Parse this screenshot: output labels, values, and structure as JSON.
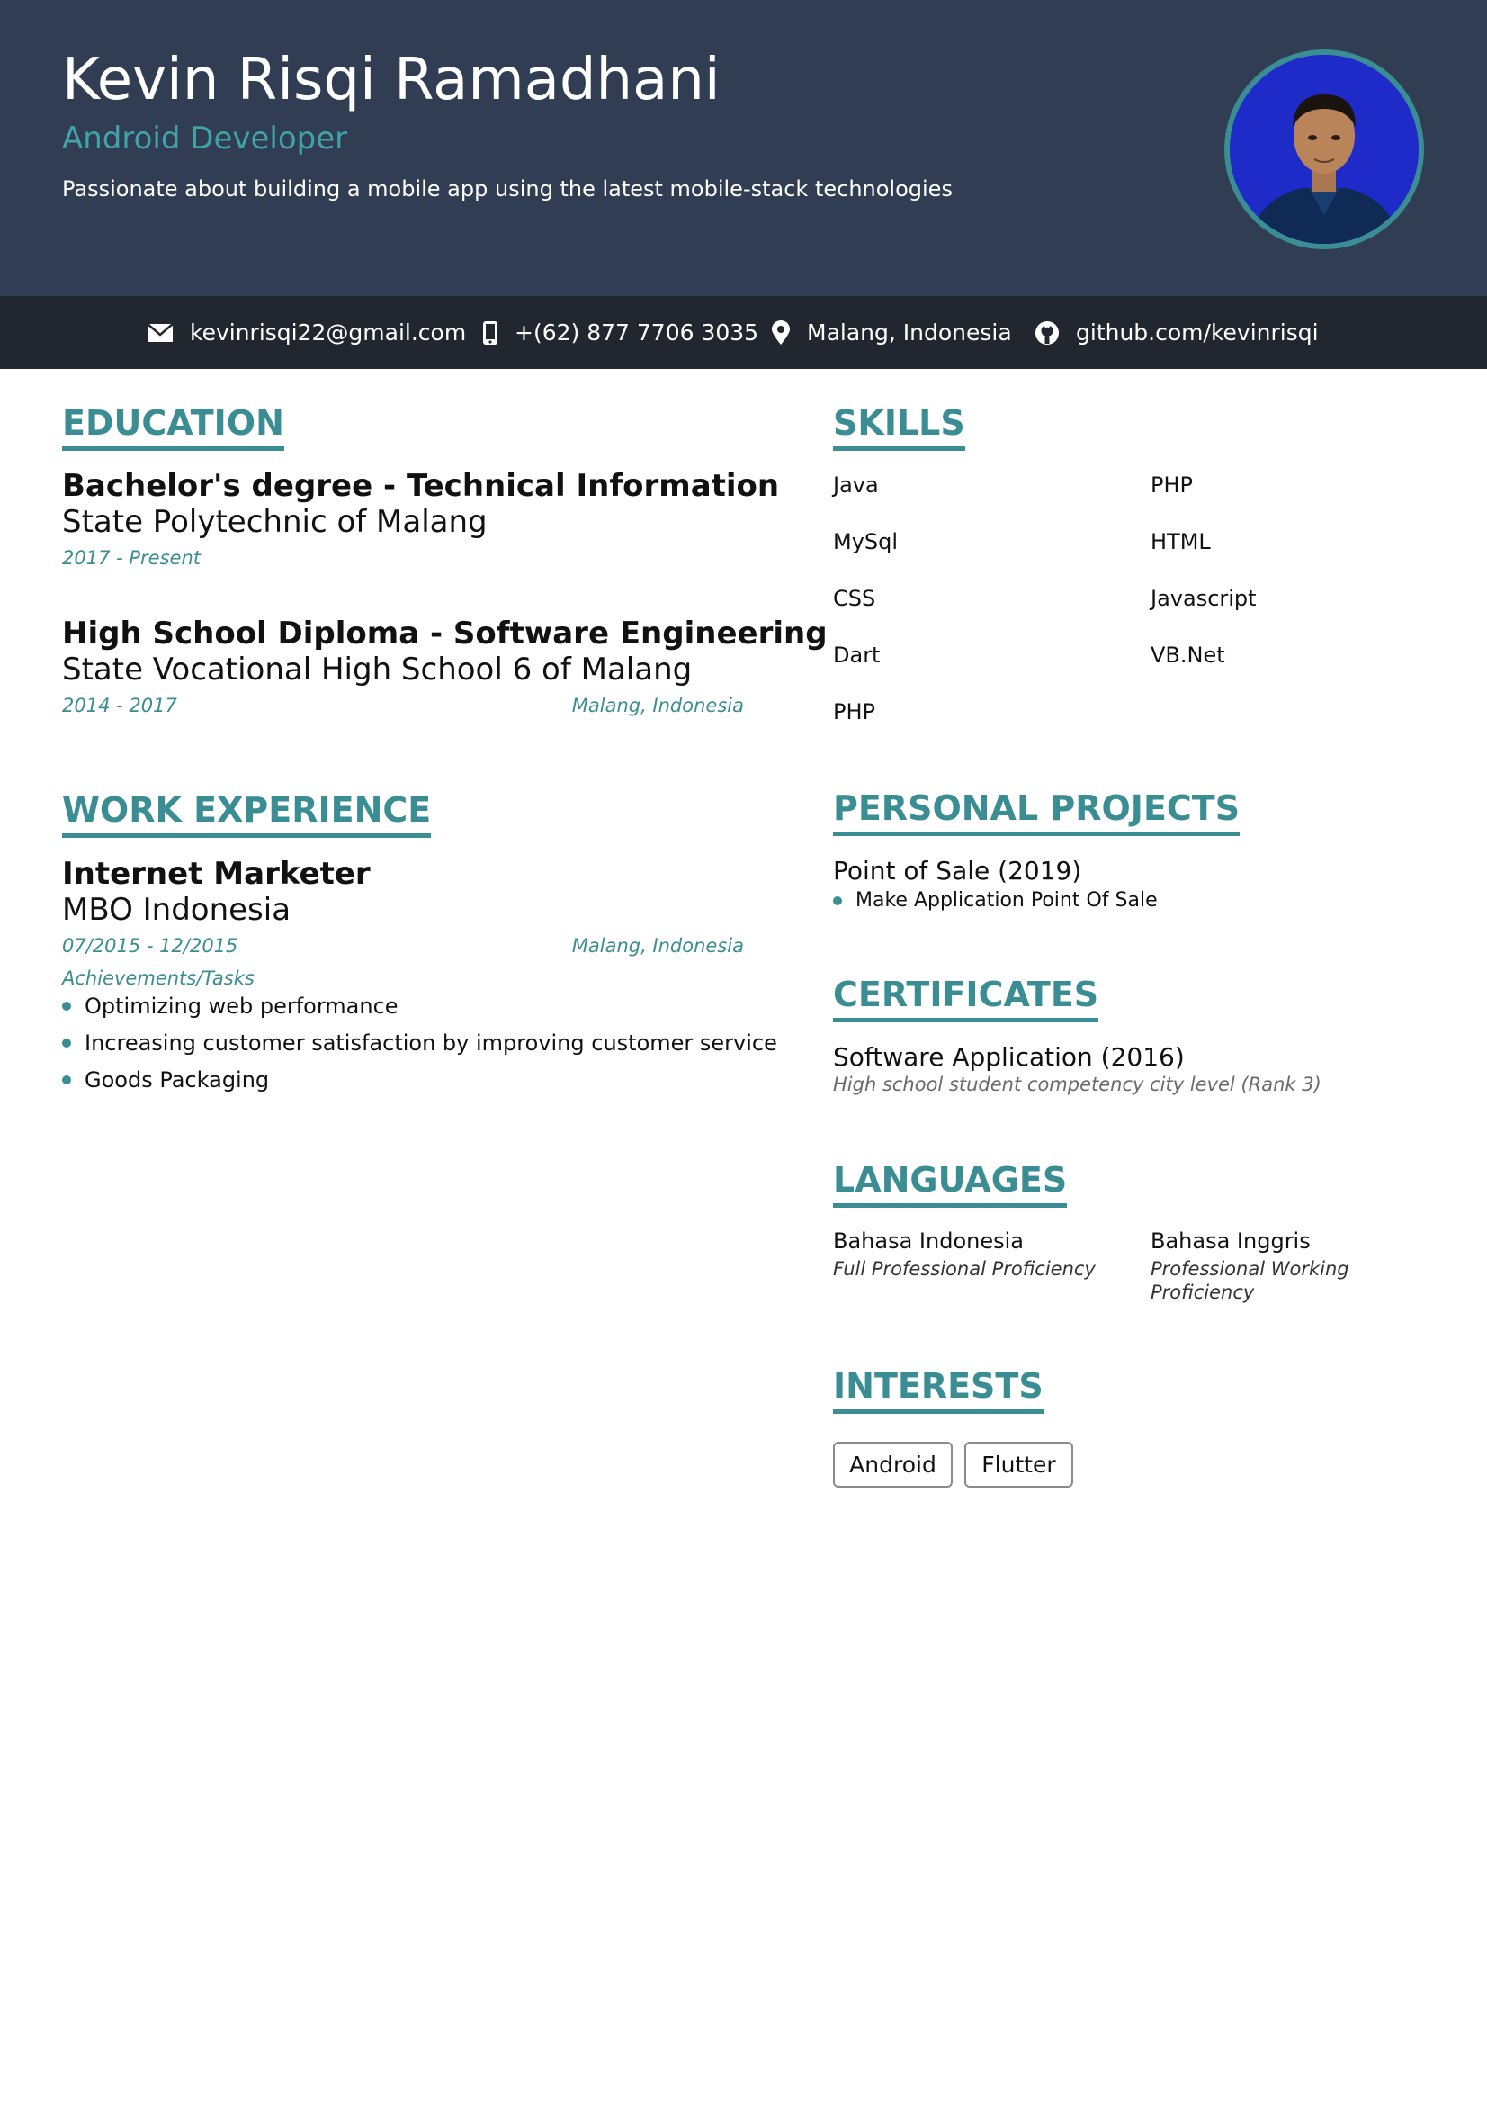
{
  "header": {
    "name": "Kevin Risqi Ramadhani",
    "role": "Android Developer",
    "summary": "Passionate about building a mobile app using the latest mobile-stack technologies"
  },
  "contact": {
    "email": "kevinrisqi22@gmail.com",
    "phone": "+(62) 877 7706 3035",
    "location": "Malang, Indonesia",
    "github": "github.com/kevinrisqi"
  },
  "education": {
    "title": "EDUCATION",
    "items": [
      {
        "degree": "Bachelor's degree - Technical Information",
        "school": "State Polytechnic of Malang",
        "dates": "2017 - Present",
        "location": ""
      },
      {
        "degree": "High School Diploma - Software Engineering",
        "school": "State Vocational High School 6 of Malang",
        "dates": "2014 - 2017",
        "location": "Malang, Indonesia"
      }
    ]
  },
  "work": {
    "title": "WORK EXPERIENCE",
    "items": [
      {
        "position": "Internet Marketer",
        "company": "MBO Indonesia",
        "dates": "07/2015 - 12/2015",
        "location": "Malang, Indonesia",
        "tasks_label": "Achievements/Tasks",
        "tasks": [
          "Optimizing web performance",
          "Increasing customer satisfaction by improving customer service",
          "Goods Packaging"
        ]
      }
    ]
  },
  "skills": {
    "title": "SKILLS",
    "items": [
      "Java",
      "PHP",
      "MySql",
      "HTML",
      "CSS",
      "Javascript",
      "Dart",
      "VB.Net",
      "PHP"
    ]
  },
  "projects": {
    "title": "PERSONAL PROJECTS",
    "items": [
      {
        "name": "Point of Sale (2019)",
        "bullets": [
          "Make Application Point Of Sale"
        ]
      }
    ]
  },
  "certificates": {
    "title": "CERTIFICATES",
    "items": [
      {
        "name": "Software Application (2016)",
        "desc": "High school student competency city level (Rank 3)"
      }
    ]
  },
  "languages": {
    "title": "LANGUAGES",
    "items": [
      {
        "name": "Bahasa Indonesia",
        "level": "Full Professional Proficiency"
      },
      {
        "name": "Bahasa Inggris",
        "level": "Professional Working Proficiency"
      }
    ]
  },
  "interests": {
    "title": "INTERESTS",
    "items": [
      "Android",
      "Flutter"
    ]
  },
  "colors": {
    "header_bg": "#313d52",
    "contact_bar_bg": "#22272f",
    "accent": "#3a8e93",
    "photo_bg": "#1f2bc8"
  },
  "icons": [
    "email-icon",
    "phone-icon",
    "location-pin-icon",
    "github-icon"
  ]
}
